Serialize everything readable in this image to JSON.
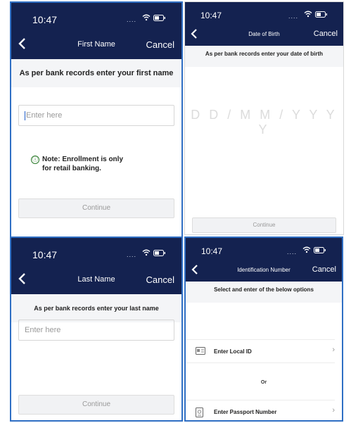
{
  "colors": {
    "navbar": "#142250",
    "accent_border": "#2f6fc4",
    "caret": "#1e5cc8",
    "note_icon": "#2b7a2b"
  },
  "screens": [
    {
      "time": "10:47",
      "nav_title": "First Name",
      "cancel": "Cancel",
      "instruction": "As per bank records enter your first name",
      "input_placeholder": "Enter here",
      "note_icon": "ⓘ",
      "note": "Note: Enrollment is only for retail banking.",
      "continue": "Continue"
    },
    {
      "time": "10:47",
      "nav_title": "Date of Birth",
      "cancel": "Cancel",
      "instruction": "As per bank records enter your date of birth",
      "date_placeholder": "D D / M M / Y Y Y Y",
      "continue": "Continue"
    },
    {
      "time": "10:47",
      "nav_title": "Last Name",
      "cancel": "Cancel",
      "instruction": "As per bank records enter your last name",
      "input_placeholder": "Enter here",
      "continue": "Continue"
    },
    {
      "time": "10:47",
      "nav_title": "Identification Number",
      "cancel": "Cancel",
      "instruction": "Select and enter of the below options",
      "option_local": "Enter Local ID",
      "or": "Or",
      "option_passport": "Enter Passport Number"
    }
  ]
}
